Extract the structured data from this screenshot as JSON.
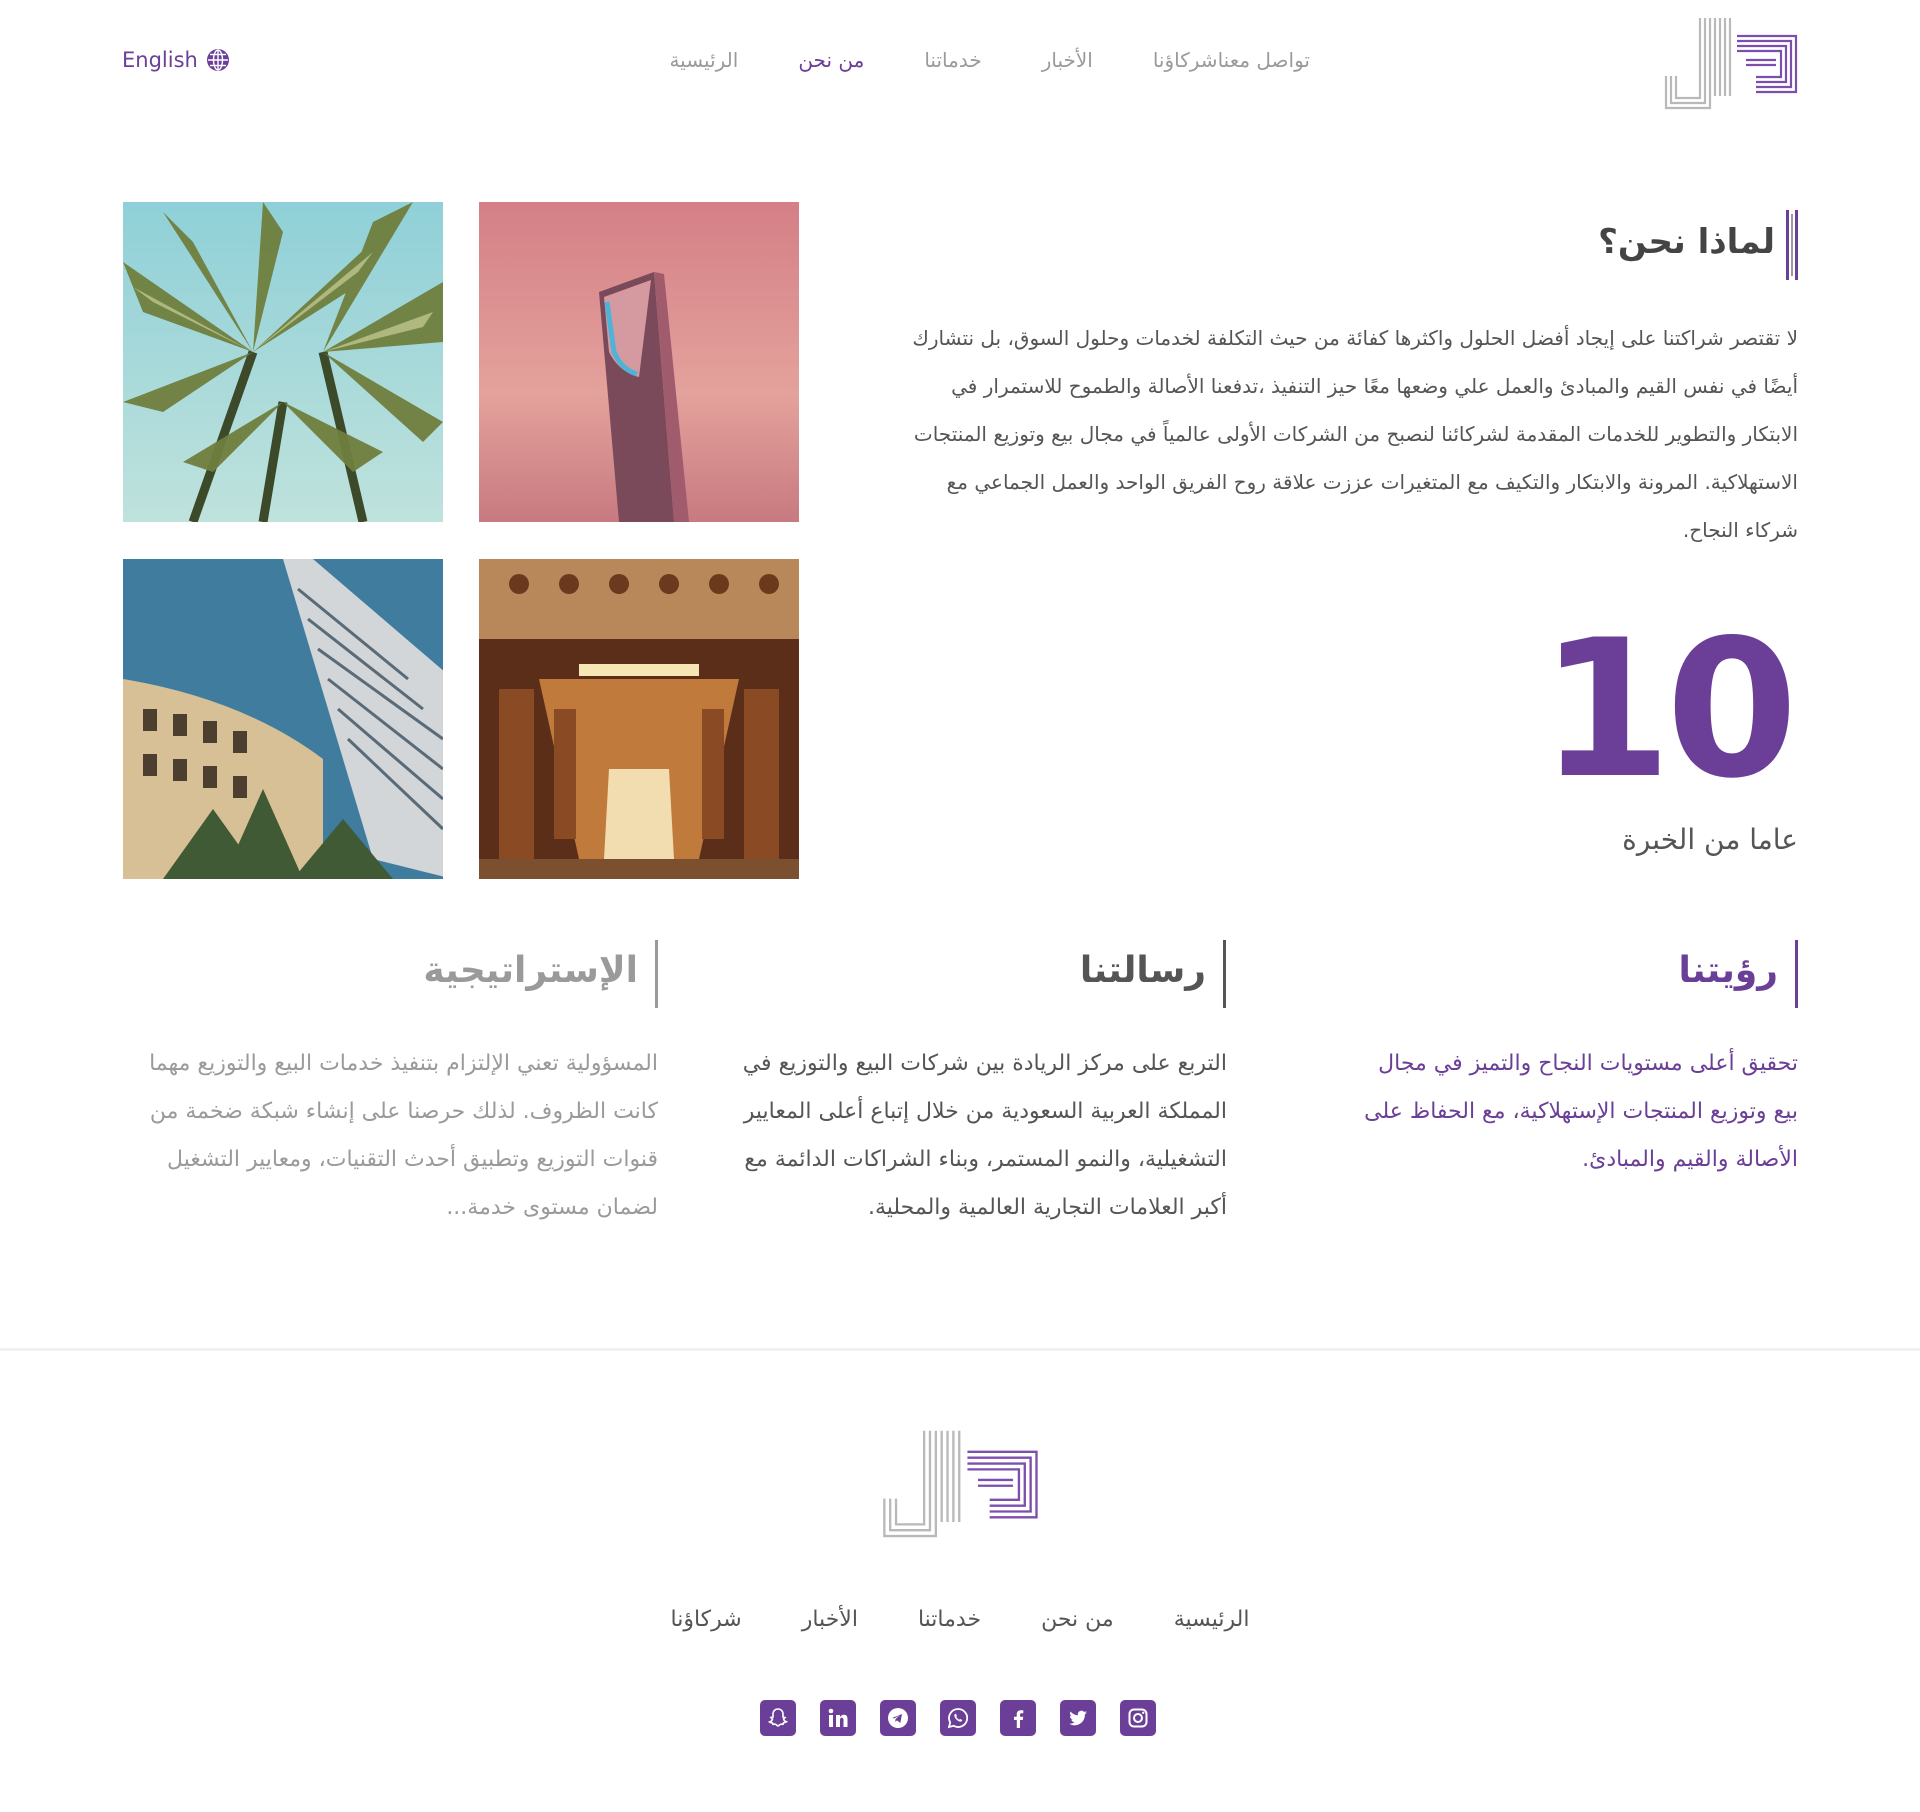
{
  "header": {
    "nav": [
      {
        "label": "الرئيسية",
        "active": false
      },
      {
        "label": "من نحن",
        "active": true
      },
      {
        "label": "خدماتنا",
        "active": false
      },
      {
        "label": "الأخبار",
        "active": false
      },
      {
        "label": "شركاؤنا",
        "active": false
      },
      {
        "label": "تواصل معنا",
        "active": false
      }
    ],
    "language": "English",
    "language_icon": "globe-icon"
  },
  "why": {
    "title": "لماذا نحن؟",
    "text": "لا تقتصر شراكتنا على إيجاد أفضل الحلول واكثرها كفائة من حيث التكلفة لخدمات وحلول السوق، بل نتشارك أيضًا في نفس القيم والمبادئ والعمل علي وضعها معًا حيز التنفيذ ،تدفعنا الأصالة والطموح للاستمرار في الابتكار والتطوير للخدمات المقدمة لشركائنا لنصبح من الشركات الأولى عالمياً في مجال بيع وتوزيع المنتجات الاستهلاكية. المرونة والابتكار والتكيف مع المتغيرات عززت علاقة روح الفريق الواحد والعمل الجماعي مع شركاء النجاح."
  },
  "experience": {
    "number": "10",
    "label": "عاما من الخبرة"
  },
  "columns": {
    "vision": {
      "title": "رؤيتنا",
      "text": "تحقيق أعلى مستويات النجاح والتميز في مجال بيع وتوزيع المنتجات الإستهلاكية، مع الحفاظ على الأصالة والقيم والمبادئ."
    },
    "mission": {
      "title": "رسالتنا",
      "text": "التربع على مركز الريادة بين شركات البيع والتوزيع في المملكة العربية السعودية من خلال إتباع أعلى المعايير التشغيلية، والنمو المستمر، وبناء الشراكات الدائمة مع أكبر العلامات التجارية العالمية والمحلية."
    },
    "strategy": {
      "title": "الإستراتيجية",
      "text": "المسؤولية تعني الإلتزام بتنفيذ خدمات البيع والتوزيع مهما كانت الظروف. لذلك حرصنا على إنشاء شبكة ضخمة من قنوات التوزيع وتطبيق أحدث التقنيات، ومعايير التشغيل لضمان مستوى خدمة..."
    }
  },
  "footer": {
    "nav": [
      "الرئيسية",
      "من نحن",
      "خدماتنا",
      "الأخبار",
      "شركاؤنا"
    ],
    "social_icons": [
      "snapchat-icon",
      "linkedin-icon",
      "telegram-icon",
      "whatsapp-icon",
      "facebook-icon",
      "twitter-icon",
      "instagram-icon"
    ]
  },
  "colors": {
    "brand_purple": "#6b3f97",
    "text_gray": "#555555",
    "muted_gray": "#9a9a9a"
  }
}
